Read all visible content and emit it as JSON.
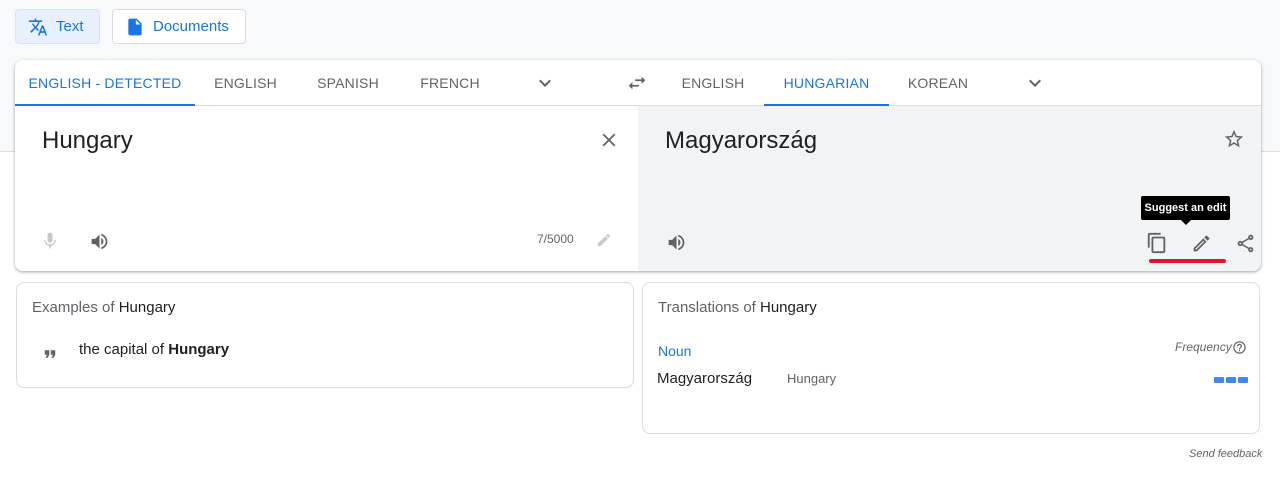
{
  "modes": {
    "text_label": "Text",
    "documents_label": "Documents"
  },
  "source_languages": [
    "ENGLISH - DETECTED",
    "ENGLISH",
    "SPANISH",
    "FRENCH"
  ],
  "target_languages": [
    "ENGLISH",
    "HUNGARIAN",
    "KOREAN"
  ],
  "source": {
    "text": "Hungary",
    "char_count": "7/5000"
  },
  "target": {
    "text": "Magyarország"
  },
  "tooltip": {
    "text": "Suggest an edit"
  },
  "examples": {
    "title_prefix": "Examples of",
    "title_term": "Hungary",
    "items": [
      {
        "before": "the capital of",
        "highlight": "Hungary"
      }
    ]
  },
  "translations": {
    "title_prefix": "Translations of",
    "title_term": "Hungary",
    "frequency_label": "Frequency",
    "entries": [
      {
        "pos": "Noun",
        "word": "Magyarország",
        "back": "Hungary",
        "frequency_level": 3
      }
    ]
  },
  "footer": {
    "feedback_label": "Send feedback"
  },
  "icons": [
    "translate-icon",
    "document-icon",
    "chevron-down-icon",
    "swap-icon",
    "close-icon",
    "mic-icon",
    "speaker-icon",
    "pencil-icon",
    "star-icon",
    "copy-icon",
    "share-icon",
    "quote-icon",
    "help-circle-icon"
  ],
  "colors": {
    "accent": "#1a73e8",
    "highlight_line": "#e8102c",
    "target_bg": "#f1f3f4"
  }
}
